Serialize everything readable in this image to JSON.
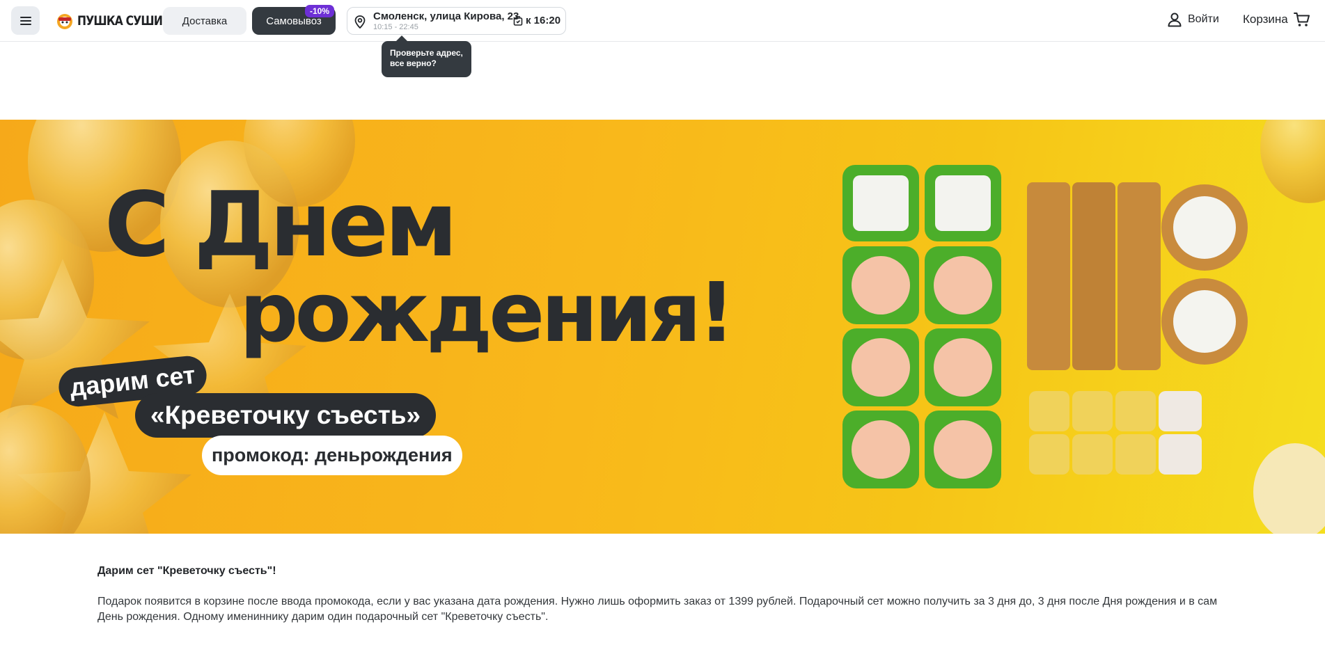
{
  "header": {
    "logo_text": "ПУШКА СУШИ",
    "delivery_label": "Доставка",
    "pickup_label": "Самовывоз",
    "pickup_badge": "-10%",
    "address": "Смоленск, улица Кирова, 23",
    "hours": "10:15 - 22:45",
    "ready_time": "к 16:20",
    "tooltip_line1": "Проверьте адрес,",
    "tooltip_line2": "все верно?",
    "login_label": "Войти",
    "cart_label": "Корзина"
  },
  "banner": {
    "title_line1": "С Днем",
    "title_line2": "рождения!",
    "gift_label": "дарим сет",
    "set_name": "«Креветочку съесть»",
    "promo": "промокод: деньрождения"
  },
  "content": {
    "title": "Дарим сет \"Креветочку съесть\"!",
    "paragraph": "Подарок появится в корзине после ввода промокода, если у вас указана дата рождения. Нужно лишь оформить заказ от 1399 рублей. Подарочный сет можно получить за 3 дня до, 3 дня после Дня рождения и в сам День рождения. Одному имениннику дарим один подарочный сет \"Креветочку съесть\"."
  },
  "colors": {
    "accent_dark": "#343a40",
    "badge_purple": "#6d2fd6",
    "banner_yellow": "#f9b81b"
  }
}
